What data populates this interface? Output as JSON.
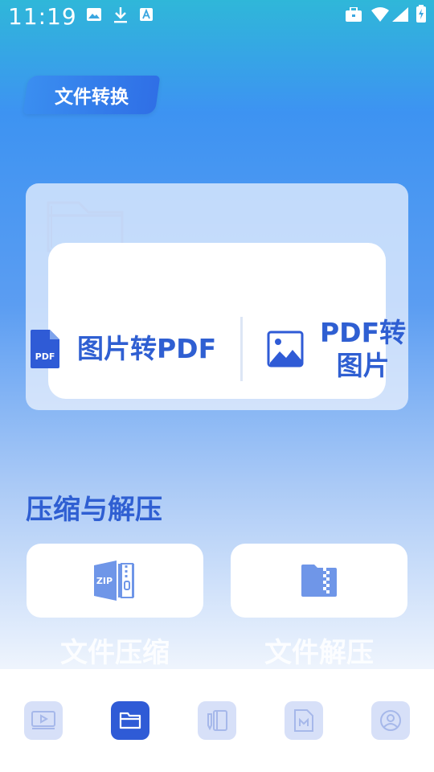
{
  "status_bar": {
    "time": "11:19",
    "left_icons": [
      "image-icon",
      "download-icon",
      "a-icon"
    ],
    "right_icons": [
      "briefcase-icon",
      "wifi-icon",
      "signal-icon",
      "battery-icon"
    ]
  },
  "header": {
    "title": "文件转换"
  },
  "convert": {
    "image_to_pdf": {
      "label": "图片转PDF",
      "icon": "pdf-file-icon"
    },
    "pdf_to_image": {
      "label_line1": "PDF转",
      "label_line2": "图片",
      "icon": "image-icon"
    }
  },
  "compress_section": {
    "title": "压缩与解压",
    "compress": {
      "label": "文件压缩",
      "icon": "zip-icon"
    },
    "decompress": {
      "label": "文件解压",
      "icon": "archive-icon"
    }
  },
  "bottom_nav": {
    "items": [
      {
        "name": "video",
        "icon": "video-icon",
        "active": false
      },
      {
        "name": "folder",
        "icon": "folder-icon",
        "active": true
      },
      {
        "name": "notes",
        "icon": "notebook-icon",
        "active": false
      },
      {
        "name": "markdown",
        "icon": "markdown-icon",
        "active": false
      },
      {
        "name": "profile",
        "icon": "profile-icon",
        "active": false
      }
    ]
  },
  "colors": {
    "accent": "#2f5fd2",
    "nav_active": "#2f5bd6",
    "nav_inactive": "#d7e0f8",
    "card_bg": "#ffffff"
  }
}
